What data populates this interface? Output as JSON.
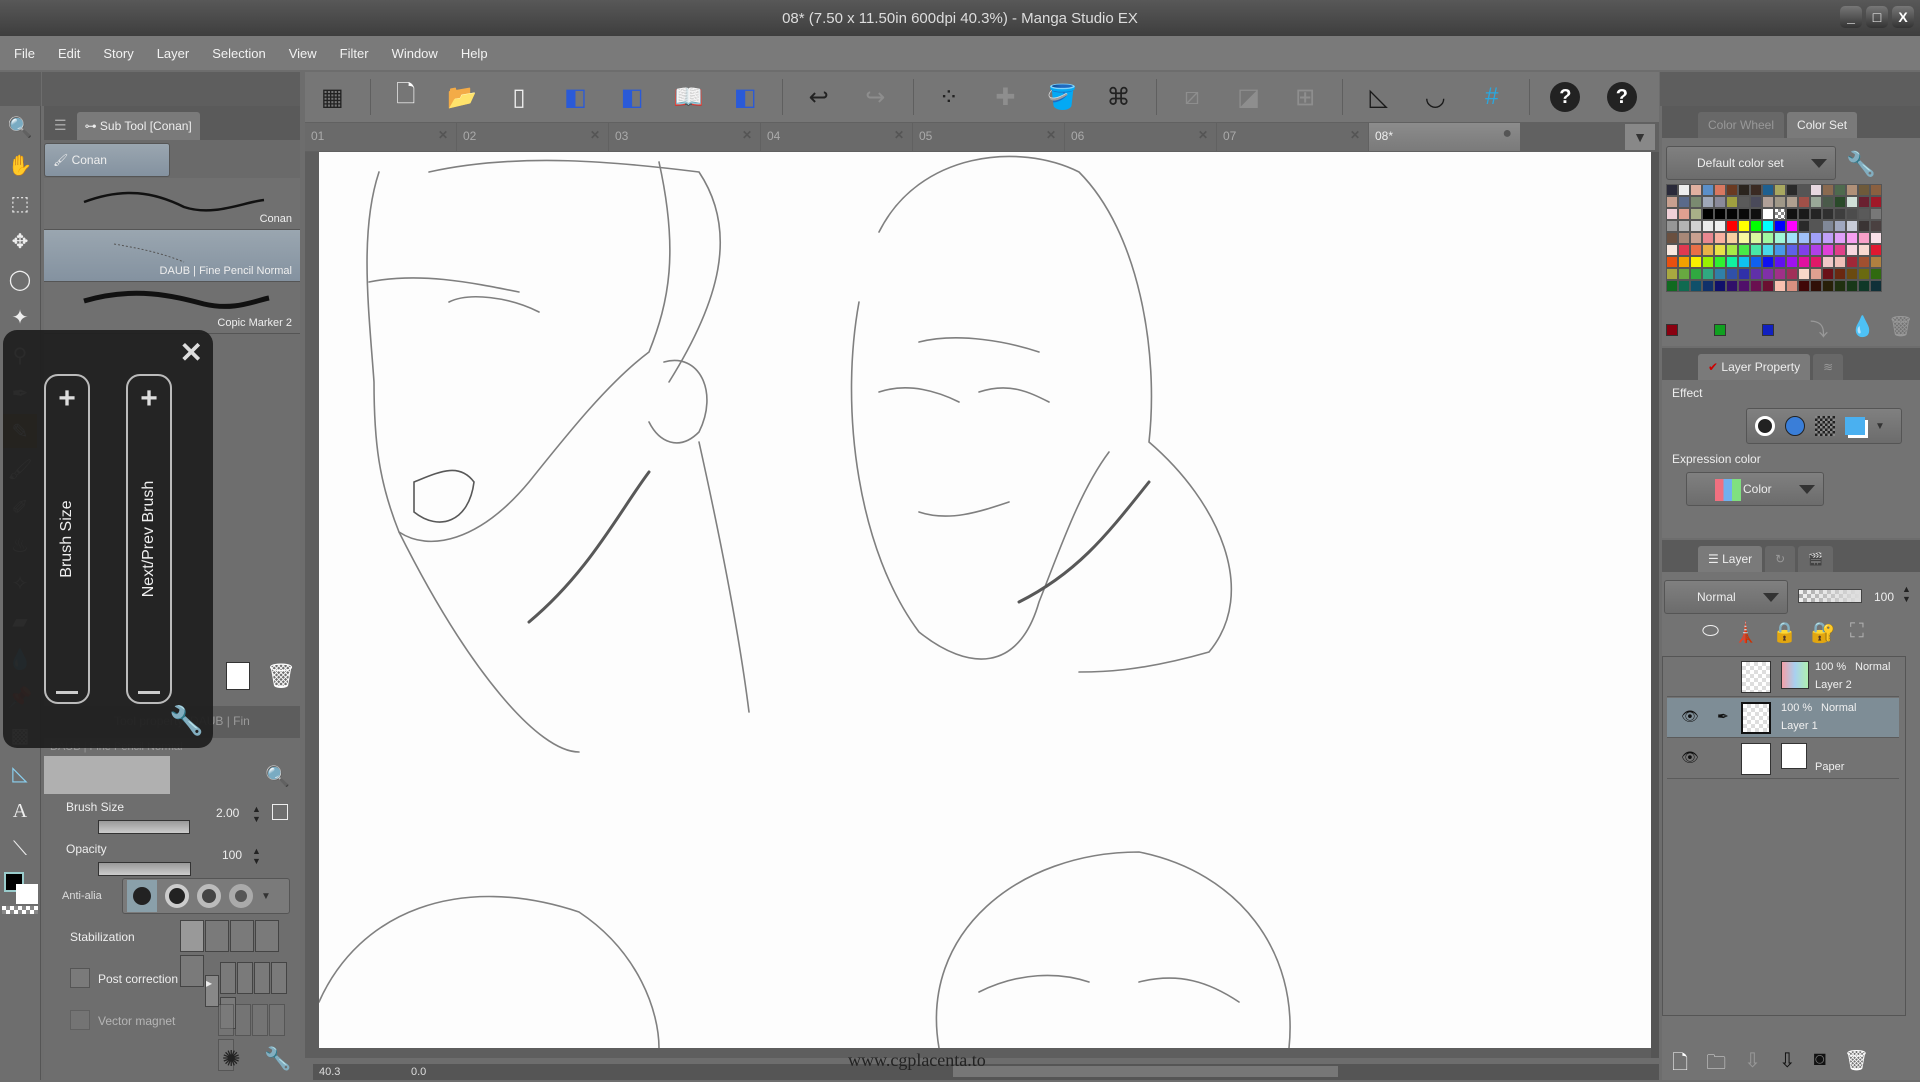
{
  "app": {
    "title": "08* (7.50 x 11.50in 600dpi 40.3%) - Manga Studio EX"
  },
  "window_controls": {
    "minimize": "_",
    "maximize": "□",
    "close": "X"
  },
  "menu": [
    "File",
    "Edit",
    "Story",
    "Layer",
    "Selection",
    "View",
    "Filter",
    "Window",
    "Help"
  ],
  "toolbar": {
    "icons": [
      "layout-icon",
      "new-file-icon",
      "open-file-icon",
      "save-icon",
      "select-page-icon",
      "select-page2-icon",
      "book-icon",
      "select-page3-icon",
      "undo-icon",
      "redo-icon",
      "scatter-icon",
      "fill-frame-icon",
      "paint-bucket-icon",
      "transform-icon",
      "ruler-off-icon",
      "ruler-slash-icon",
      "grid-frame-icon",
      "snap-ruler-icon",
      "snap-special-ruler-icon",
      "snap-grid-icon",
      "help-icon",
      "help2-icon"
    ]
  },
  "doc_tabs": [
    {
      "label": "01",
      "active": false
    },
    {
      "label": "02",
      "active": false
    },
    {
      "label": "03",
      "active": false
    },
    {
      "label": "04",
      "active": false
    },
    {
      "label": "05",
      "active": false
    },
    {
      "label": "06",
      "active": false
    },
    {
      "label": "07",
      "active": false
    },
    {
      "label": "08*",
      "active": true
    }
  ],
  "subtool_panel": {
    "title": "Sub Tool [Conan]",
    "group": "Conan",
    "brushes": [
      {
        "label": "Conan",
        "selected": false
      },
      {
        "label": "DAUB | Fine Pencil Normal",
        "selected": true
      },
      {
        "label": "Copic Marker 2",
        "selected": false
      }
    ]
  },
  "overlay": {
    "brush_size_label": "Brush Size",
    "next_prev_label": "Next/Prev Brush",
    "plus": "+",
    "close": "✕"
  },
  "tool_property": {
    "title": "Tool property [DAUB | Fin",
    "brush_name": "DAUB | Fine Pencil Normal",
    "brush_size": {
      "label": "Brush Size",
      "value": "2.00",
      "fill": 0.6
    },
    "opacity": {
      "label": "Opacity",
      "value": "100",
      "fill": 1.0
    },
    "anti_alias": {
      "label": "Anti-alia",
      "selected_index": 0
    },
    "stabilization": {
      "label": "Stabilization"
    },
    "post_correction": {
      "label": "Post correction",
      "checked": false
    },
    "vector_magnet": {
      "label": "Vector magnet",
      "checked": false,
      "enabled": false
    }
  },
  "color_panel": {
    "tabs": [
      {
        "label": "Color Wheel",
        "active": false
      },
      {
        "label": "Color Set",
        "active": true
      }
    ],
    "color_set": "Default color set",
    "swatches": [
      "#2a2a3a",
      "#eeeeee",
      "#e0b0a0",
      "#5b8fc8",
      "#d87860",
      "#6a3a22",
      "#2a241e",
      "#3a2a22",
      "#1e5f8f",
      "#a8a860",
      "#2a2a2a",
      "#555",
      "#e8d8e0",
      "#8a6a50",
      "#4e6a4e",
      "#b09078",
      "#6e5a3a",
      "#8a6040",
      "#c8a090",
      "#5a6a8a",
      "#7a8a70",
      "#a0a8b8",
      "#8a8a9a",
      "#a0a040",
      "#5a5a5a",
      "#4a4a5a",
      "#b0a098",
      "#a09888",
      "#b0a090",
      "#a05048",
      "#9aa898",
      "#4a5a4a",
      "#2a4a2a",
      "#d0e0d8",
      "#6a2030",
      "#a01828",
      "#f0d0d8",
      "#e0a090",
      "#a8b088",
      "#000000",
      "#000",
      "#050505",
      "#0a0a0a",
      "#101010",
      "#ffffff",
      "checker",
      "#111",
      "#1a1a1a",
      "#242424",
      "#303030",
      "#3e3e3e",
      "#4c4c4c",
      "#5a5a5a",
      "#787878",
      "#969696",
      "#b4b4b4",
      "#d2d2d2",
      "#ebebeb",
      "#f0f0f0",
      "#ff0000",
      "#ffff00",
      "#00ff00",
      "#00ffff",
      "#0000ff",
      "#ff00ff",
      "#2a2a2a",
      "#555555",
      "#808898",
      "#a0a8c0",
      "#c8ccd8",
      "#3a3434",
      "#4a4040",
      "#6a5040",
      "#a88878",
      "#c8a090",
      "#e88890",
      "#f8b0a0",
      "#f8d0a0",
      "#f8f8a0",
      "#d8f8a0",
      "#a0f8a0",
      "#a0f8d8",
      "#a0e0f8",
      "#a0c0f8",
      "#a0a0f8",
      "#c0a0f8",
      "#e0a0f8",
      "#f8a0f0",
      "#f8a0c8",
      "#f8e0e8",
      "#f8e8e0",
      "#e03850",
      "#e87048",
      "#e8b048",
      "#e8e048",
      "#a8e848",
      "#48e848",
      "#48e8a8",
      "#48d8e8",
      "#4898e8",
      "#6060e8",
      "#8040e8",
      "#b040e8",
      "#e040d8",
      "#e04088",
      "#f8d8e0",
      "#f8d8d0",
      "#e01830",
      "#e85010",
      "#f0a000",
      "#f8f000",
      "#98f000",
      "#30f030",
      "#10f0a0",
      "#10c0f0",
      "#1060f0",
      "#1010f0",
      "#6010f0",
      "#a010f0",
      "#e010a0",
      "#e01868",
      "#f0c8c8",
      "#f0c0b8",
      "#a02838",
      "#a05030",
      "#b08040",
      "#a8a840",
      "#68a840",
      "#30a840",
      "#30a880",
      "#3080a8",
      "#3050a8",
      "#3030a8",
      "#6030a8",
      "#8030a8",
      "#a03088",
      "#a03058",
      "#f8d8c8",
      "#e0a090",
      "#6a1018",
      "#6a2810",
      "#6a4a10",
      "#6a6a10",
      "#306a10",
      "#106a20",
      "#106a50",
      "#10506a",
      "#10306a",
      "#10106a",
      "#30106a",
      "#50106a",
      "#6a1050",
      "#6a1030",
      "#f8c0b0",
      "#d89080",
      "#400808",
      "#301008",
      "#282008",
      "#203010",
      "#183818",
      "#103828",
      "#103038",
      "#102038",
      "#101030",
      "#201030",
      "#281028",
      "#301020",
      "#b08070",
      "#e0b890"
    ],
    "bottom_swatches": [
      "#8a0010",
      "#10a020",
      "#1020c0"
    ]
  },
  "layer_property": {
    "tab_label": "Layer Property",
    "effect_label": "Effect",
    "expression_color_label": "Expression color",
    "expression_color_value": "Color"
  },
  "layer_panel": {
    "tab_label": "Layer",
    "blend_mode": "Normal",
    "opacity": "100",
    "layers": [
      {
        "opacity": "100 %",
        "mode": "Normal",
        "name": "Layer 2",
        "visible": false,
        "editing": false,
        "selected": false
      },
      {
        "opacity": "100 %",
        "mode": "Normal",
        "name": "Layer 1",
        "visible": true,
        "editing": true,
        "selected": true
      },
      {
        "opacity": "",
        "mode": "",
        "name": "Paper",
        "visible": true,
        "editing": false,
        "selected": false
      }
    ]
  },
  "status": {
    "zoom": "40.3",
    "rotation": "0.0"
  },
  "watermark": "www.cgplacenta.to"
}
